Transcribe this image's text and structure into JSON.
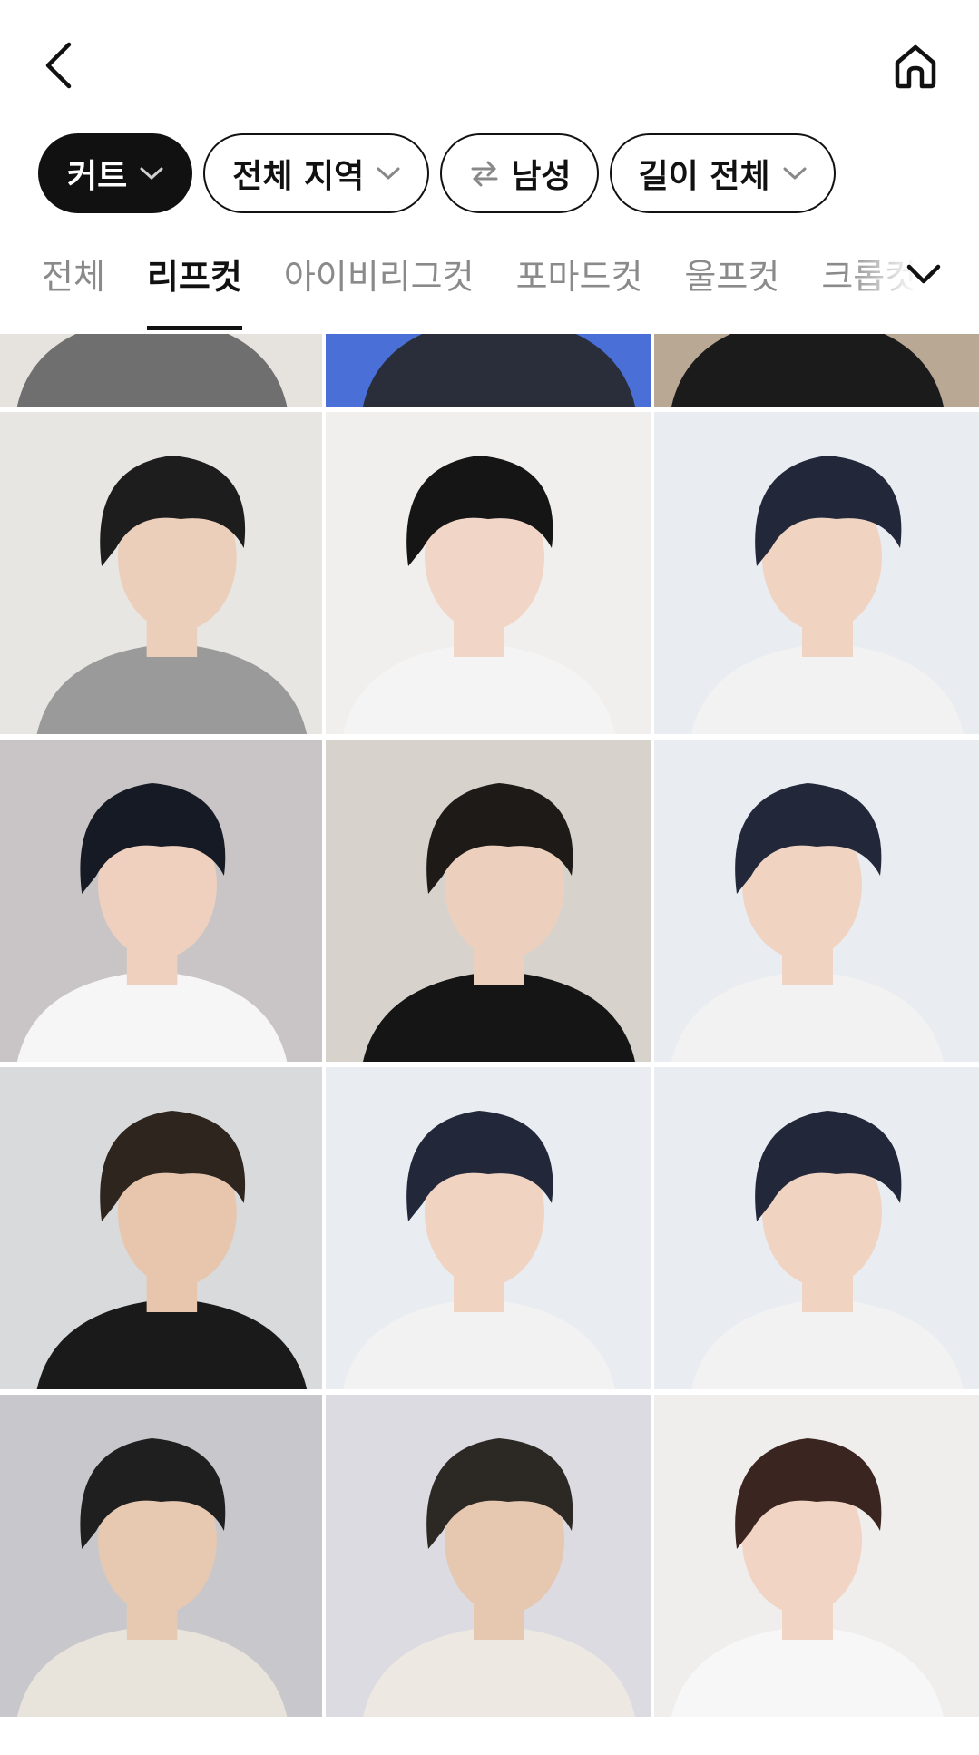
{
  "header": {
    "back_icon": "chevron-left-icon",
    "home_icon": "home-icon"
  },
  "filters": [
    {
      "label": "커트",
      "active": true,
      "icon": "chevron-down-icon"
    },
    {
      "label": "전체 지역",
      "active": false,
      "icon": "chevron-down-icon"
    },
    {
      "label": "남성",
      "active": false,
      "icon": "swap-arrows-icon"
    },
    {
      "label": "길이 전체",
      "active": false,
      "icon": "chevron-down-icon"
    }
  ],
  "tabs": [
    {
      "label": "전체",
      "active": false
    },
    {
      "label": "리프컷",
      "active": true
    },
    {
      "label": "아이비리그컷",
      "active": false
    },
    {
      "label": "포마드컷",
      "active": false
    },
    {
      "label": "울프컷",
      "active": false
    },
    {
      "label": "크롭컷",
      "active": false
    }
  ],
  "tabs_expand_icon": "chevron-down-icon",
  "gallery": [
    {
      "bg": "#e6e3df",
      "hair": "#2b2b2b",
      "shirt": "#6f6f6f",
      "skin": "#e7c9b3"
    },
    {
      "bg": "#4a6fd6",
      "hair": "#1a1a1a",
      "shirt": "#2a2e3a",
      "skin": "#e9cdb8"
    },
    {
      "bg": "#b9a894",
      "hair": "#1a1a1a",
      "shirt": "#1b1b1b",
      "skin": "#e5c6ae"
    },
    {
      "bg": "#e8e6e3",
      "hair": "#1d1d1d",
      "shirt": "#9a9a9a",
      "skin": "#eccfba"
    },
    {
      "bg": "#f0efee",
      "hair": "#151515",
      "shirt": "#f4f4f4",
      "skin": "#f1d5c6"
    },
    {
      "bg": "#e9ecf1",
      "hair": "#22283a",
      "shirt": "#f2f2f2",
      "skin": "#f0d3c1"
    },
    {
      "bg": "#c9c5c6",
      "hair": "#161a24",
      "shirt": "#f6f6f6",
      "skin": "#efd0bf"
    },
    {
      "bg": "#d7d3cc",
      "hair": "#1e1a17",
      "shirt": "#151515",
      "skin": "#ecd0bd"
    },
    {
      "bg": "#e9ecf1",
      "hair": "#22283a",
      "shirt": "#f2f2f2",
      "skin": "#f0d3c1"
    },
    {
      "bg": "#d9dadb",
      "hair": "#2d251e",
      "shirt": "#1a1a1a",
      "skin": "#e8c6ae"
    },
    {
      "bg": "#e9ecf1",
      "hair": "#22283a",
      "shirt": "#f2f2f2",
      "skin": "#f0d3c1"
    },
    {
      "bg": "#e9ecf1",
      "hair": "#22283a",
      "shirt": "#f2f2f2",
      "skin": "#f0d3c1"
    },
    {
      "bg": "#c8c8cc",
      "hair": "#1f1f1f",
      "shirt": "#e8e4dc",
      "skin": "#e7c8b1"
    },
    {
      "bg": "#dcdbe2",
      "hair": "#2c2824",
      "shirt": "#ede9e2",
      "skin": "#e6c7b0"
    },
    {
      "bg": "#f0eeec",
      "hair": "#3a2520",
      "shirt": "#f7f7f7",
      "skin": "#f1d4c4"
    }
  ],
  "colors": {
    "text_primary": "#111111",
    "text_inactive": "#8a8a8a",
    "chip_active_bg": "#111111",
    "background": "#ffffff"
  }
}
